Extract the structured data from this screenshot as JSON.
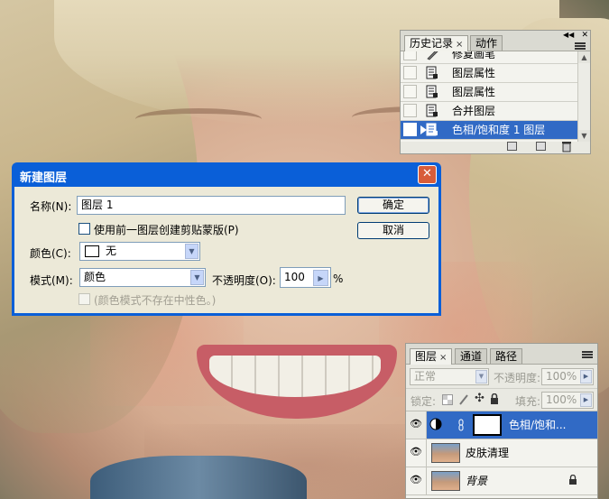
{
  "history_panel": {
    "tabs": [
      {
        "label": "历史记录",
        "close": "×"
      },
      {
        "label": "动作"
      }
    ],
    "rows": [
      {
        "label": "修复画笔",
        "icon": "healing-brush-icon",
        "selected": false
      },
      {
        "label": "图层属性",
        "icon": "history-state-icon",
        "selected": false
      },
      {
        "label": "图层属性",
        "icon": "history-state-icon",
        "selected": false
      },
      {
        "label": "合并图层",
        "icon": "history-state-icon",
        "selected": false
      },
      {
        "label": "色相/饱和度 1 图层",
        "icon": "history-state-icon",
        "selected": true
      }
    ],
    "menu_icon": "panel-menu-icon",
    "footer_icons": [
      "new-document-from-state-icon",
      "new-snapshot-icon",
      "delete-icon"
    ]
  },
  "dialog": {
    "title": "新建图层",
    "close_symbol": "✕",
    "name_label": "名称(N):",
    "name_value": "图层 1",
    "clip_checkbox_label": "使用前一图层创建剪贴蒙版(P)",
    "color_label": "颜色(C):",
    "color_value": "无",
    "mode_label": "模式(M):",
    "mode_value": "颜色",
    "opacity_label": "不透明度(O):",
    "opacity_value": "100",
    "opacity_unit": "%",
    "neutral_checkbox_label": "(颜色模式不存在中性色。)",
    "ok_label": "确定",
    "cancel_label": "取消"
  },
  "layers_panel": {
    "tabs": [
      {
        "label": "图层",
        "close": "×"
      },
      {
        "label": "通道"
      },
      {
        "label": "路径"
      }
    ],
    "blend_mode": "正常",
    "opacity_label": "不透明度:",
    "opacity_value": "100%",
    "lock_label": "锁定:",
    "fill_label": "填充:",
    "fill_value": "100%",
    "layers": [
      {
        "name": "色相/饱和...",
        "type": "adjustment",
        "selected": true,
        "visible": true
      },
      {
        "name": "皮肤清理",
        "type": "pixel",
        "selected": false,
        "visible": true
      },
      {
        "name": "背景",
        "type": "background",
        "selected": false,
        "visible": true,
        "locked": true
      }
    ]
  },
  "colors": {
    "selection_blue": "#316ac5",
    "titlebar_blue": "#0a5fd8",
    "dialog_face": "#ece9d8",
    "close_red": "#d85d3a"
  }
}
